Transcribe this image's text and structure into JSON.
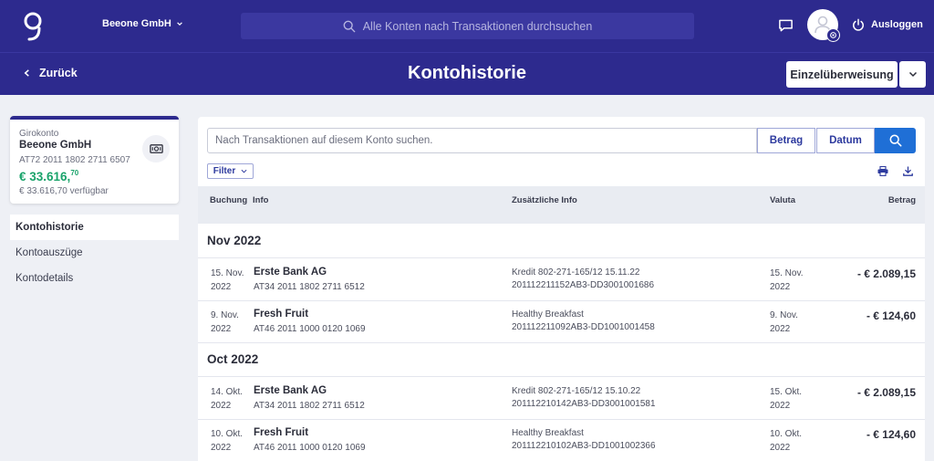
{
  "header": {
    "company": "Beeone GmbH",
    "search_placeholder": "Alle Konten nach Transaktionen durchsuchen",
    "logout": "Ausloggen"
  },
  "subheader": {
    "back": "Zurück",
    "title": "Kontohistorie",
    "transfer": "Einzelüberweisung"
  },
  "account": {
    "type": "Girokonto",
    "name": "Beeone GmbH",
    "iban": "AT72 2011 1802 2711 6507",
    "balance_main": "€ 33.616,",
    "balance_cents": "70",
    "available": "€ 33.616,70 verfügbar"
  },
  "sidebar": {
    "items": [
      {
        "label": "Kontohistorie"
      },
      {
        "label": "Kontoauszüge"
      },
      {
        "label": "Kontodetails"
      }
    ]
  },
  "main": {
    "search_placeholder": "Nach Transaktionen auf diesem Konto suchen.",
    "btn_amount": "Betrag",
    "btn_date": "Datum",
    "filter": "Filter",
    "columns": {
      "booking": "Buchung",
      "info": "Info",
      "extra": "Zusätzliche Info",
      "valuta": "Valuta",
      "amount": "Betrag"
    },
    "groups": [
      {
        "label": "Nov 2022",
        "rows": [
          {
            "date": "15. Nov. 2022",
            "name": "Erste Bank AG",
            "iban": "AT34 2011 1802 2711 6512",
            "ref1": "Kredit 802-271-165/12 15.11.22",
            "ref2": "201112211152AB3-DD3001001686",
            "valuta": "15. Nov. 2022",
            "amount": "- € 2.089,15"
          },
          {
            "date": "9. Nov. 2022",
            "name": "Fresh Fruit",
            "iban": "AT46 2011 1000 0120 1069",
            "ref1": "Healthy Breakfast",
            "ref2": "201112211092AB3-DD1001001458",
            "valuta": "9. Nov. 2022",
            "amount": "- € 124,60"
          }
        ]
      },
      {
        "label": "Oct 2022",
        "rows": [
          {
            "date": "14. Okt. 2022",
            "name": "Erste Bank AG",
            "iban": "AT34 2011 1802 2711 6512",
            "ref1": "Kredit 802-271-165/12 15.10.22",
            "ref2": "201112210142AB3-DD3001001581",
            "valuta": "15. Okt. 2022",
            "amount": "- € 2.089,15"
          },
          {
            "date": "10. Okt. 2022",
            "name": "Fresh Fruit",
            "iban": "AT46 2011 1000 0120 1069",
            "ref1": "Healthy Breakfast",
            "ref2": "201112210102AB3-DD1001002366",
            "valuta": "10. Okt. 2022",
            "amount": "- € 124,60"
          }
        ]
      }
    ]
  },
  "colors": {
    "brand": "#2d2a8e",
    "primary_button": "#1f6fd6",
    "positive": "#1aa36b"
  },
  "icons": [
    "logo",
    "chevron-down-icon",
    "search-icon",
    "chat-icon",
    "user-icon",
    "settings-badge-icon",
    "power-icon",
    "chevron-left-icon",
    "cash-icon",
    "print-icon",
    "download-icon"
  ]
}
